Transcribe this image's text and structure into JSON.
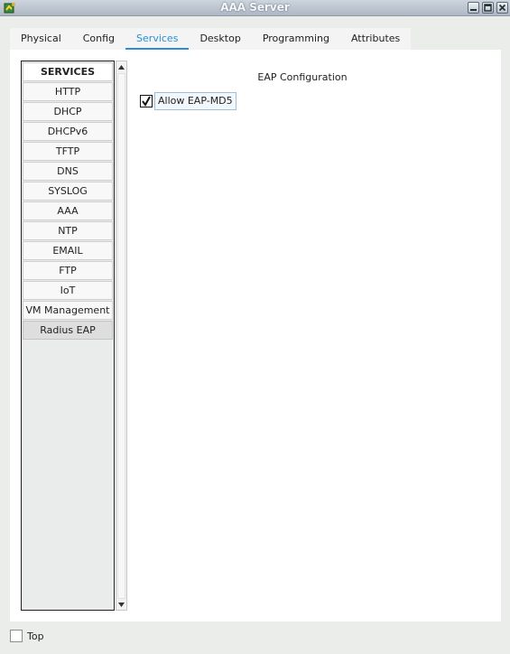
{
  "window": {
    "title": "AAA Server"
  },
  "tabs": [
    {
      "label": "Physical",
      "active": false
    },
    {
      "label": "Config",
      "active": false
    },
    {
      "label": "Services",
      "active": true
    },
    {
      "label": "Desktop",
      "active": false
    },
    {
      "label": "Programming",
      "active": false
    },
    {
      "label": "Attributes",
      "active": false
    }
  ],
  "services": {
    "header": "SERVICES",
    "items": [
      "HTTP",
      "DHCP",
      "DHCPv6",
      "TFTP",
      "DNS",
      "SYSLOG",
      "AAA",
      "NTP",
      "EMAIL",
      "FTP",
      "IoT",
      "VM Management",
      "Radius EAP"
    ],
    "selected": "Radius EAP"
  },
  "eap": {
    "section_title": "EAP Configuration",
    "allow_md5_label": "Allow EAP-MD5",
    "allow_md5_checked": true
  },
  "footer": {
    "top_label": "Top",
    "top_checked": false
  },
  "colors": {
    "accent": "#2a8fd8",
    "titlebar": "#aeb8c4"
  }
}
